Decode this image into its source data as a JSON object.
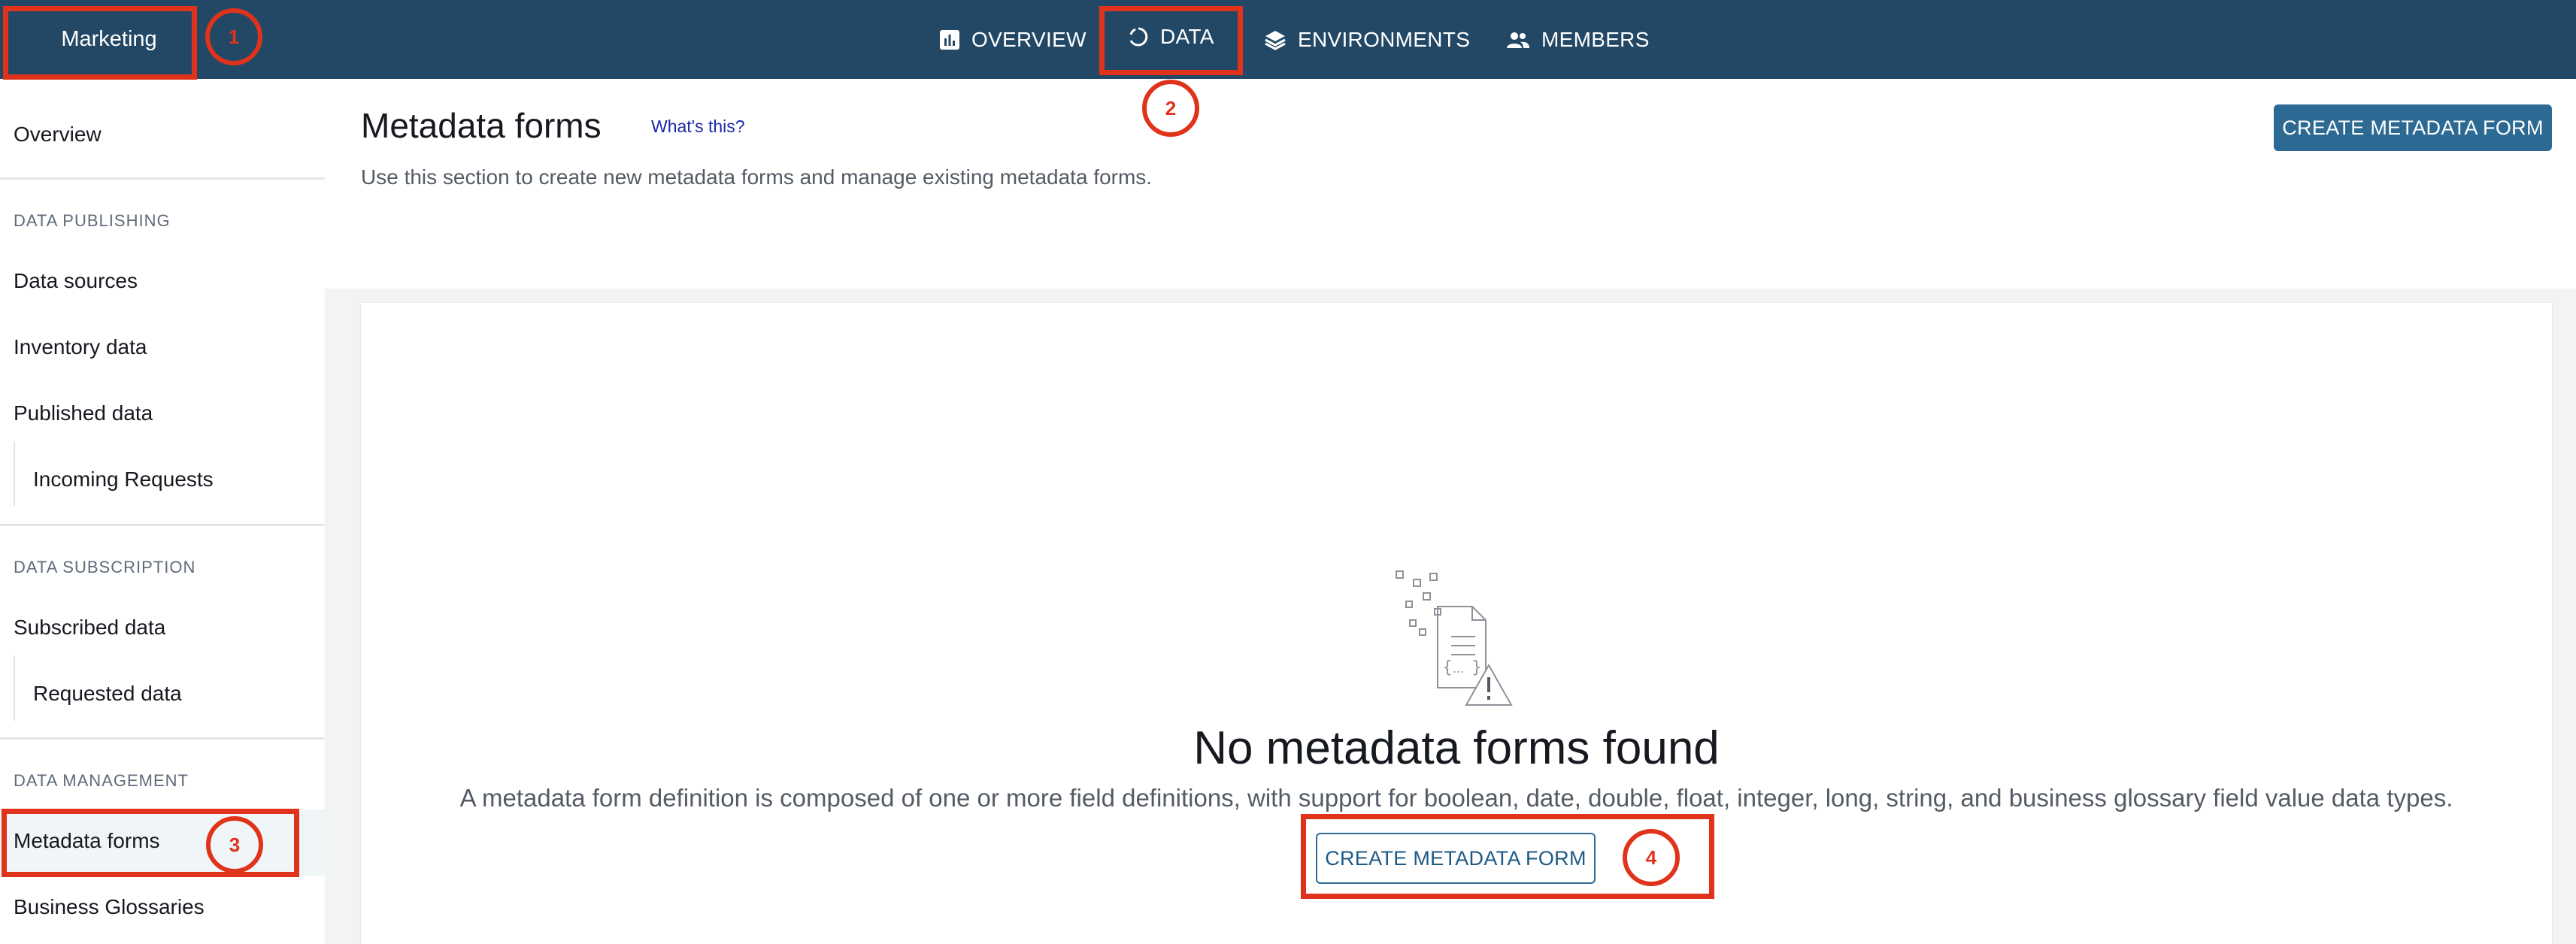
{
  "topbar": {
    "project_name": "Marketing",
    "tabs": [
      {
        "label": "OVERVIEW",
        "icon": "bar-chart-icon"
      },
      {
        "label": "DATA",
        "icon": "circle-spinner-icon"
      },
      {
        "label": "ENVIRONMENTS",
        "icon": "layers-icon"
      },
      {
        "label": "MEMBERS",
        "icon": "people-icon"
      }
    ]
  },
  "sidebar": {
    "overview": "Overview",
    "sections": [
      {
        "title": "DATA PUBLISHING",
        "items": [
          "Data sources",
          "Inventory data",
          "Published data",
          "Incoming Requests"
        ]
      },
      {
        "title": "DATA SUBSCRIPTION",
        "items": [
          "Subscribed data",
          "Requested data"
        ]
      },
      {
        "title": "DATA MANAGEMENT",
        "items": [
          "Metadata forms",
          "Business Glossaries"
        ]
      }
    ]
  },
  "main": {
    "title": "Metadata forms",
    "whats_this": "What's this?",
    "description": "Use this section to create new metadata forms and manage existing metadata forms.",
    "create_button": "CREATE METADATA FORM",
    "empty_state": {
      "title": "No metadata forms found",
      "description": "A metadata form definition is composed of one or more field definitions, with support for boolean, date, double, float, integer, long, string, and business glossary field value data types.",
      "button": "CREATE METADATA FORM",
      "icon": "document-warning-icon"
    }
  },
  "annotations": {
    "step1": "1",
    "step2": "2",
    "step3": "3",
    "step4": "4",
    "color": "#e0331b"
  },
  "colors": {
    "topbar": "#234865",
    "primary_button": "#2d6a93",
    "link": "#1a2aa8"
  }
}
